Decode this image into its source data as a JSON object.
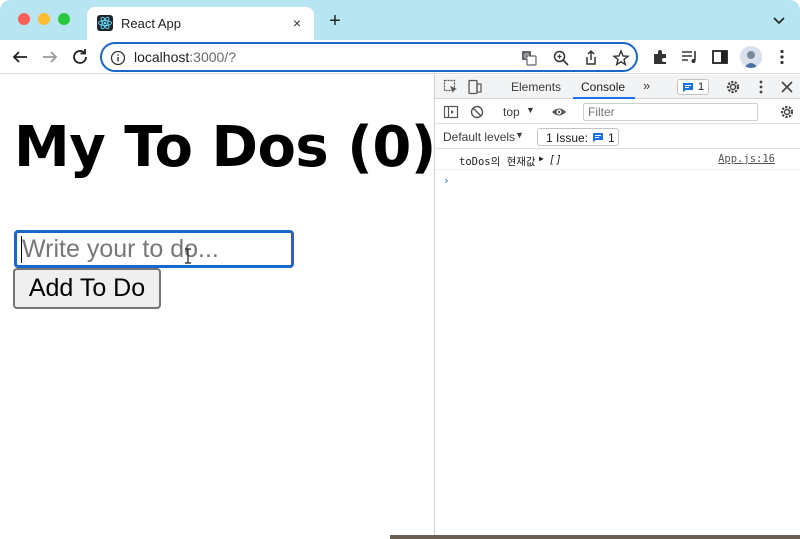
{
  "browser": {
    "tab_title": "React App",
    "tab_close": "×",
    "new_tab": "+",
    "url_host": "localhost",
    "url_rest": ":3000/?"
  },
  "page": {
    "heading": "My To Dos (0)",
    "input_placeholder": "Write your to do...",
    "add_button": "Add To Do"
  },
  "devtools": {
    "tabs": [
      "Elements",
      "Console"
    ],
    "more_tabs": "»",
    "messages_badge": "1",
    "context": "top",
    "filter_placeholder": "Filter",
    "levels_label": "Default levels",
    "issue_label": "1 Issue:",
    "issue_count": "1",
    "log": {
      "message": "toDos의 현재값",
      "value": "[]",
      "source": "App.js:16"
    },
    "prompt": "›"
  },
  "colors": {
    "tabstrip": "#b7e6f2",
    "focus_blue": "#1a66c9"
  }
}
